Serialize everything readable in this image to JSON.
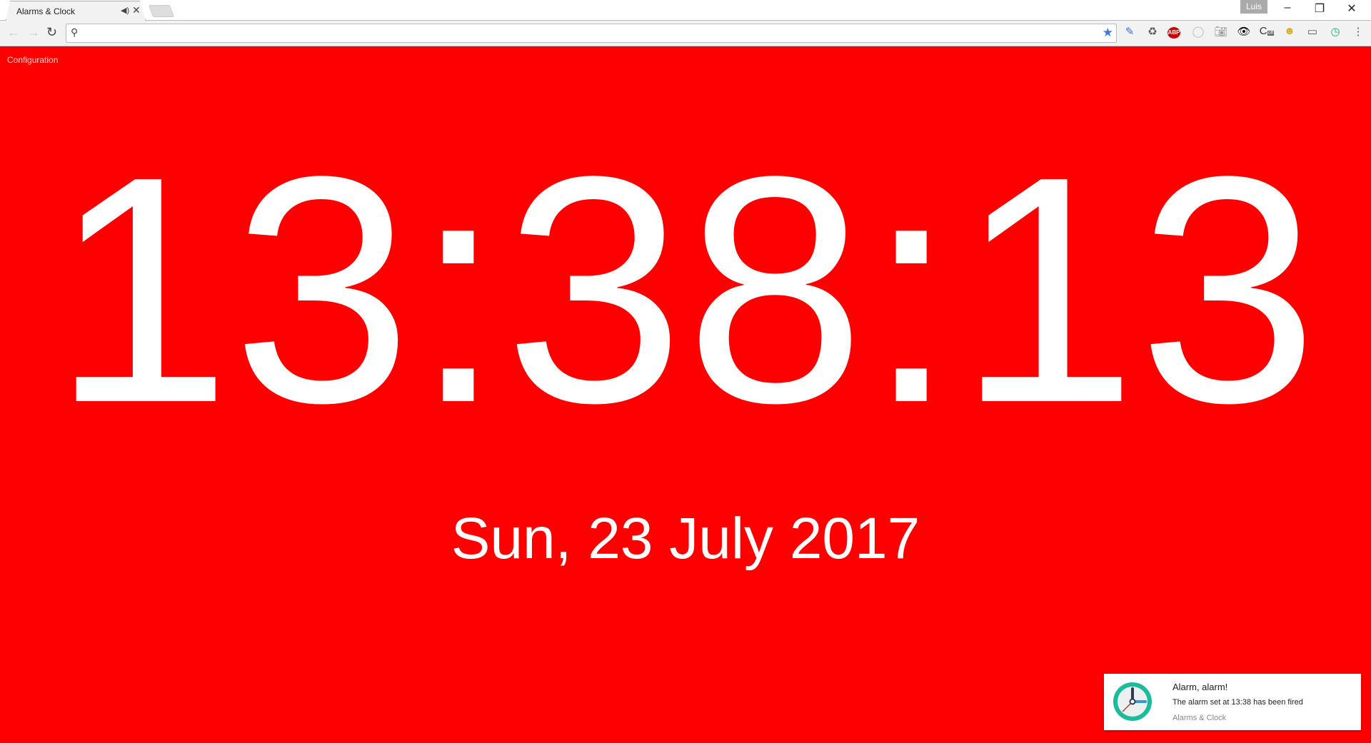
{
  "browser": {
    "tab_title": "Alarms & Clock",
    "profile_name": "Luis",
    "address_value": "",
    "icons": [
      "audio-icon",
      "close-tab-icon",
      "back-icon",
      "forward-icon",
      "reload-icon",
      "search-icon",
      "bookmark-star-icon",
      "eyedropper-icon",
      "recycle-icon",
      "adblock-icon",
      "json-icon",
      "camera-icon",
      "eye-icon",
      "caffeine-off-icon",
      "image-ext-icon",
      "cast-icon",
      "alarm-clock-ext-icon",
      "menu-icon"
    ],
    "ext_badge": "off"
  },
  "page": {
    "config_link": "Configuration",
    "time": "13:38:13",
    "date": "Sun, 23 July 2017",
    "background_color": "#ff0000"
  },
  "notification": {
    "title": "Alarm, alarm!",
    "message": "The alarm set at 13:38 has been fired",
    "source": "Alarms & Clock"
  }
}
